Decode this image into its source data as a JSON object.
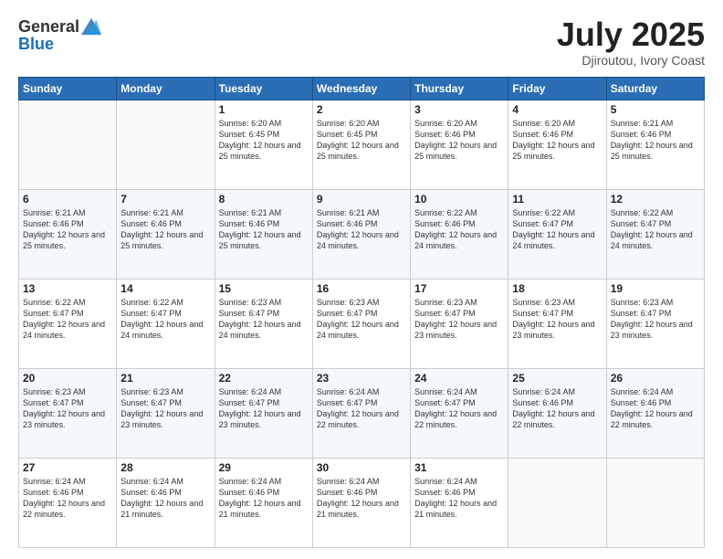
{
  "header": {
    "logo_line1": "General",
    "logo_line2": "Blue",
    "month_title": "July 2025",
    "location": "Djiroutou, Ivory Coast"
  },
  "days_of_week": [
    "Sunday",
    "Monday",
    "Tuesday",
    "Wednesday",
    "Thursday",
    "Friday",
    "Saturday"
  ],
  "weeks": [
    [
      {
        "day": "",
        "info": ""
      },
      {
        "day": "",
        "info": ""
      },
      {
        "day": "1",
        "info": "Sunrise: 6:20 AM\nSunset: 6:45 PM\nDaylight: 12 hours and 25 minutes."
      },
      {
        "day": "2",
        "info": "Sunrise: 6:20 AM\nSunset: 6:45 PM\nDaylight: 12 hours and 25 minutes."
      },
      {
        "day": "3",
        "info": "Sunrise: 6:20 AM\nSunset: 6:46 PM\nDaylight: 12 hours and 25 minutes."
      },
      {
        "day": "4",
        "info": "Sunrise: 6:20 AM\nSunset: 6:46 PM\nDaylight: 12 hours and 25 minutes."
      },
      {
        "day": "5",
        "info": "Sunrise: 6:21 AM\nSunset: 6:46 PM\nDaylight: 12 hours and 25 minutes."
      }
    ],
    [
      {
        "day": "6",
        "info": "Sunrise: 6:21 AM\nSunset: 6:46 PM\nDaylight: 12 hours and 25 minutes."
      },
      {
        "day": "7",
        "info": "Sunrise: 6:21 AM\nSunset: 6:46 PM\nDaylight: 12 hours and 25 minutes."
      },
      {
        "day": "8",
        "info": "Sunrise: 6:21 AM\nSunset: 6:46 PM\nDaylight: 12 hours and 25 minutes."
      },
      {
        "day": "9",
        "info": "Sunrise: 6:21 AM\nSunset: 6:46 PM\nDaylight: 12 hours and 24 minutes."
      },
      {
        "day": "10",
        "info": "Sunrise: 6:22 AM\nSunset: 6:46 PM\nDaylight: 12 hours and 24 minutes."
      },
      {
        "day": "11",
        "info": "Sunrise: 6:22 AM\nSunset: 6:47 PM\nDaylight: 12 hours and 24 minutes."
      },
      {
        "day": "12",
        "info": "Sunrise: 6:22 AM\nSunset: 6:47 PM\nDaylight: 12 hours and 24 minutes."
      }
    ],
    [
      {
        "day": "13",
        "info": "Sunrise: 6:22 AM\nSunset: 6:47 PM\nDaylight: 12 hours and 24 minutes."
      },
      {
        "day": "14",
        "info": "Sunrise: 6:22 AM\nSunset: 6:47 PM\nDaylight: 12 hours and 24 minutes."
      },
      {
        "day": "15",
        "info": "Sunrise: 6:23 AM\nSunset: 6:47 PM\nDaylight: 12 hours and 24 minutes."
      },
      {
        "day": "16",
        "info": "Sunrise: 6:23 AM\nSunset: 6:47 PM\nDaylight: 12 hours and 24 minutes."
      },
      {
        "day": "17",
        "info": "Sunrise: 6:23 AM\nSunset: 6:47 PM\nDaylight: 12 hours and 23 minutes."
      },
      {
        "day": "18",
        "info": "Sunrise: 6:23 AM\nSunset: 6:47 PM\nDaylight: 12 hours and 23 minutes."
      },
      {
        "day": "19",
        "info": "Sunrise: 6:23 AM\nSunset: 6:47 PM\nDaylight: 12 hours and 23 minutes."
      }
    ],
    [
      {
        "day": "20",
        "info": "Sunrise: 6:23 AM\nSunset: 6:47 PM\nDaylight: 12 hours and 23 minutes."
      },
      {
        "day": "21",
        "info": "Sunrise: 6:23 AM\nSunset: 6:47 PM\nDaylight: 12 hours and 23 minutes."
      },
      {
        "day": "22",
        "info": "Sunrise: 6:24 AM\nSunset: 6:47 PM\nDaylight: 12 hours and 23 minutes."
      },
      {
        "day": "23",
        "info": "Sunrise: 6:24 AM\nSunset: 6:47 PM\nDaylight: 12 hours and 22 minutes."
      },
      {
        "day": "24",
        "info": "Sunrise: 6:24 AM\nSunset: 6:47 PM\nDaylight: 12 hours and 22 minutes."
      },
      {
        "day": "25",
        "info": "Sunrise: 6:24 AM\nSunset: 6:46 PM\nDaylight: 12 hours and 22 minutes."
      },
      {
        "day": "26",
        "info": "Sunrise: 6:24 AM\nSunset: 6:46 PM\nDaylight: 12 hours and 22 minutes."
      }
    ],
    [
      {
        "day": "27",
        "info": "Sunrise: 6:24 AM\nSunset: 6:46 PM\nDaylight: 12 hours and 22 minutes."
      },
      {
        "day": "28",
        "info": "Sunrise: 6:24 AM\nSunset: 6:46 PM\nDaylight: 12 hours and 21 minutes."
      },
      {
        "day": "29",
        "info": "Sunrise: 6:24 AM\nSunset: 6:46 PM\nDaylight: 12 hours and 21 minutes."
      },
      {
        "day": "30",
        "info": "Sunrise: 6:24 AM\nSunset: 6:46 PM\nDaylight: 12 hours and 21 minutes."
      },
      {
        "day": "31",
        "info": "Sunrise: 6:24 AM\nSunset: 6:46 PM\nDaylight: 12 hours and 21 minutes."
      },
      {
        "day": "",
        "info": ""
      },
      {
        "day": "",
        "info": ""
      }
    ]
  ]
}
